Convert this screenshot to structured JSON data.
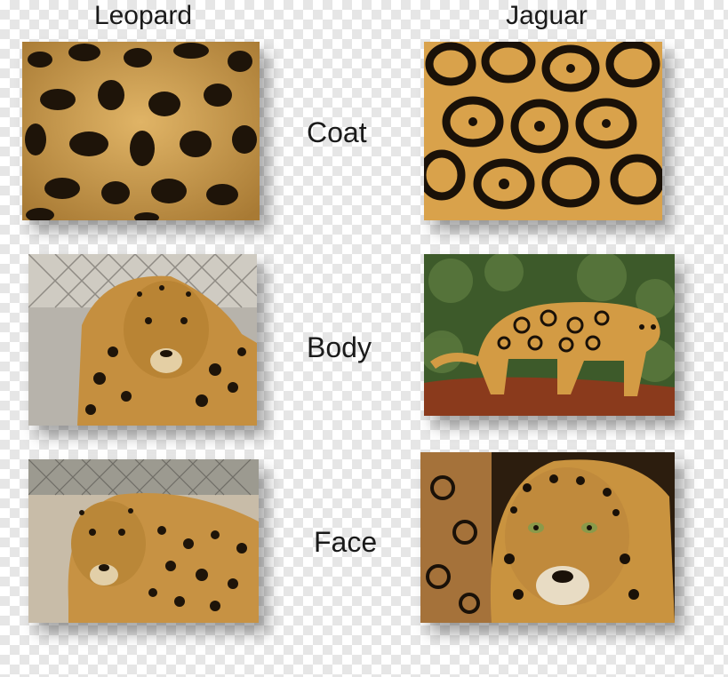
{
  "columns": {
    "left": "Leopard",
    "right": "Jaguar"
  },
  "rows": {
    "coat": "Coat",
    "body": "Body",
    "face": "Face"
  },
  "photos": {
    "leopard_coat": "leopard coat fur rosettes",
    "jaguar_coat": "jaguar coat fur rosettes",
    "leopard_body": "leopard standing by chain-link fence",
    "jaguar_body": "jaguar walking on a log in foliage",
    "leopard_face": "leopard lying on ground near fence",
    "jaguar_face": "jaguar face close-up"
  },
  "colors": {
    "fur_base": "#c9962f",
    "fur_light": "#e6bf6c",
    "spot": "#1e1409",
    "foliage": "#3d5a2a",
    "log": "#8a3a1c"
  }
}
